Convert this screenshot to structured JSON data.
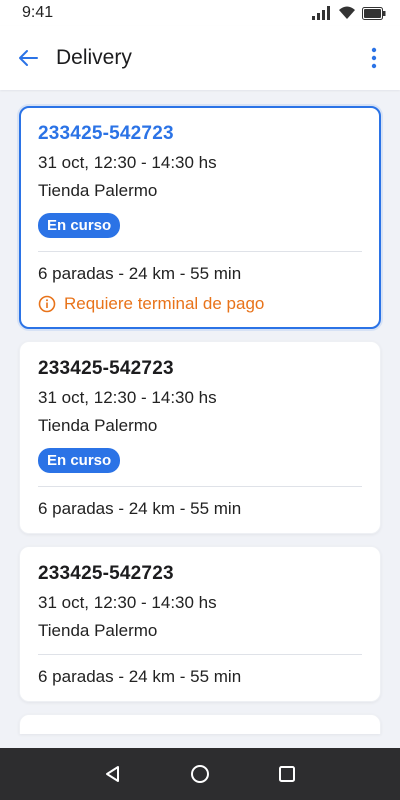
{
  "status_bar": {
    "time": "9:41"
  },
  "app_bar": {
    "title": "Delivery"
  },
  "deliveries": [
    {
      "id": "233425-542723",
      "date": "31 oct, 12:30 - 14:30 hs",
      "store": "Tienda Palermo",
      "badge": "En curso",
      "summary": "6 paradas - 24 km - 55 min",
      "warning": "Requiere terminal de pago",
      "selected": true
    },
    {
      "id": "233425-542723",
      "date": "31 oct, 12:30 - 14:30 hs",
      "store": "Tienda Palermo",
      "badge": "En curso",
      "summary": "6 paradas - 24 km - 55 min"
    },
    {
      "id": "233425-542723",
      "date": "31 oct, 12:30 - 14:30 hs",
      "store": "Tienda Palermo",
      "summary": "6 paradas - 24 km - 55 min"
    }
  ],
  "colors": {
    "accent": "#2b73e6",
    "warning": "#e8731a",
    "background": "#f0f2f7",
    "nav_bar": "#2d2d2f"
  },
  "icons": {
    "back": "arrow-left-icon",
    "more": "more-vert-icon",
    "warning": "info-circle-icon",
    "nav_back": "triangle-back-icon",
    "nav_home": "circle-home-icon",
    "nav_recents": "square-recents-icon"
  }
}
